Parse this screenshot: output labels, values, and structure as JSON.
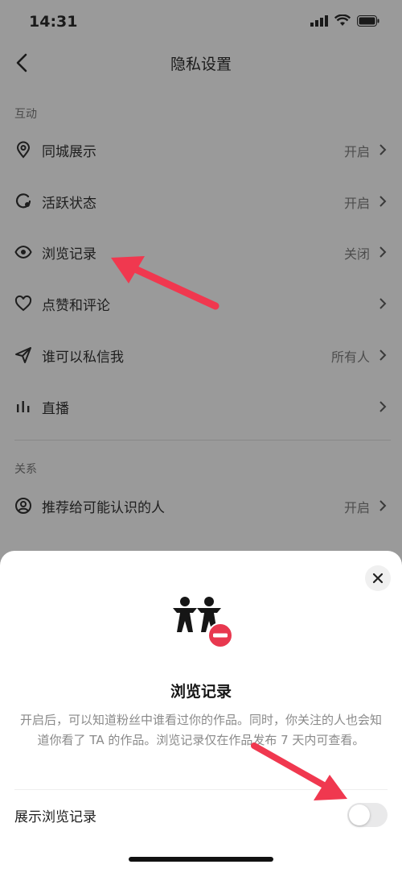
{
  "status_bar": {
    "time": "14:31"
  },
  "nav": {
    "title": "隐私设置"
  },
  "sections": [
    {
      "label": "互动"
    },
    {
      "label": "关系"
    }
  ],
  "rows": [
    {
      "label": "同城展示",
      "value": "开启",
      "icon": "location-pin-icon"
    },
    {
      "label": "活跃状态",
      "value": "开启",
      "icon": "active-status-icon"
    },
    {
      "label": "浏览记录",
      "value": "关闭",
      "icon": "eye-icon"
    },
    {
      "label": "点赞和评论",
      "value": "",
      "icon": "heart-icon"
    },
    {
      "label": "谁可以私信我",
      "value": "所有人",
      "icon": "paper-plane-icon"
    },
    {
      "label": "直播",
      "value": "",
      "icon": "bar-chart-icon"
    },
    {
      "label": "推荐给可能认识的人",
      "value": "开启",
      "icon": "user-circle-icon"
    }
  ],
  "sheet": {
    "title": "浏览记录",
    "description": "开启后，可以知道粉丝中谁看过你的作品。同时，你关注的人也会知道你看了 TA 的作品。浏览记录仅在作品发布 7 天内可查看。",
    "toggle_label": "展示浏览记录",
    "toggle_on": false,
    "hero_icon": "people-remove-icon"
  },
  "colors": {
    "accent_red": "#f0384f",
    "arrow_red": "#f0384f"
  }
}
